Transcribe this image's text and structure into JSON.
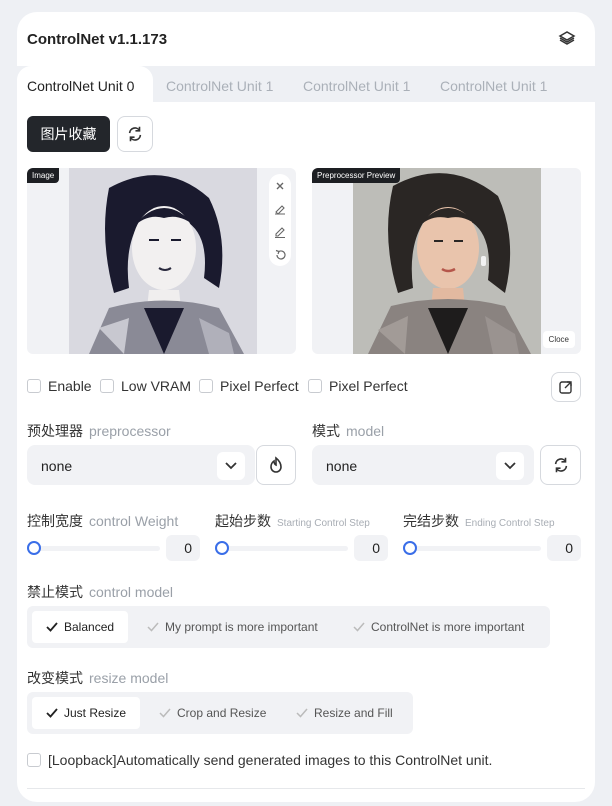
{
  "header": {
    "title": "ControlNet v1.1.173",
    "menu_icon": "stack-menu-icon"
  },
  "tabs": [
    {
      "label": "ControlNet Unit 0",
      "active": true
    },
    {
      "label": "ControlNet Unit 1",
      "active": false
    },
    {
      "label": "ControlNet Unit 1",
      "active": false
    },
    {
      "label": "ControlNet Unit 1",
      "active": false
    }
  ],
  "toolbar": {
    "gallery_label": "图片收藏",
    "refresh_icon": "refresh-icon"
  },
  "image_panel": {
    "tag": "Image",
    "tools": [
      "close-icon",
      "brush-icon",
      "edit-icon",
      "undo-icon"
    ]
  },
  "preview_panel": {
    "tag": "Preprocessor Preview",
    "close_label": "Cloce"
  },
  "checkboxes": [
    {
      "label": "Enable",
      "checked": false
    },
    {
      "label": "Low VRAM",
      "checked": false
    },
    {
      "label": "Pixel Perfect",
      "checked": false
    },
    {
      "label": "Pixel Perfect",
      "checked": false
    }
  ],
  "preprocessor": {
    "label": "预处理器",
    "sub": "preprocessor",
    "value": "none"
  },
  "model": {
    "label": "模式",
    "sub": "model",
    "value": "none"
  },
  "control_weight": {
    "label": "控制宽度",
    "sub": "control Weight",
    "value": "0"
  },
  "starting_step": {
    "label": "起始步数",
    "sub": "Starting Control Step",
    "value": "0"
  },
  "ending_step": {
    "label": "完结步数",
    "sub": "Ending Control Step",
    "value": "0"
  },
  "control_mode": {
    "label": "禁止模式",
    "sub": "control model",
    "options": [
      "Balanced",
      "My prompt is more important",
      "ControlNet is more important"
    ],
    "selected": "Balanced"
  },
  "resize_mode": {
    "label": "改变模式",
    "sub": "resize model",
    "options": [
      "Just Resize",
      "Crop and Resize",
      "Resize and Fill"
    ],
    "selected": "Just Resize"
  },
  "loopback": {
    "label": "[Loopback]Automatically send generated images to this ControlNet unit.",
    "checked": false
  },
  "colors": {
    "accent": "#3a6ee8",
    "dark_button": "#23262b",
    "panel_bg": "#f1f2f5"
  }
}
